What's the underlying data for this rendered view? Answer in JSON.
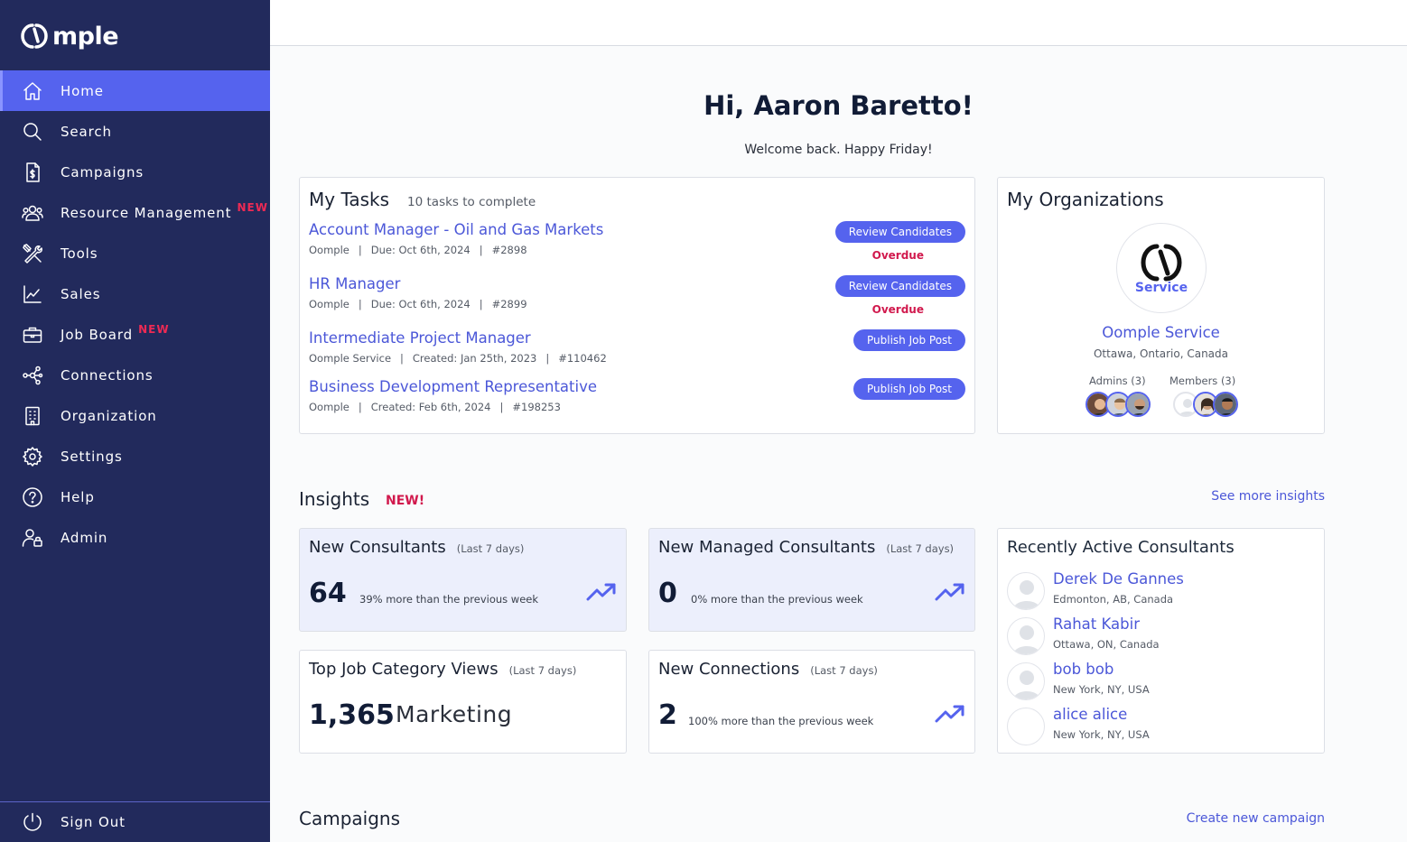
{
  "app": {
    "name": "Oomple",
    "logo_text": "mple"
  },
  "sidebar": {
    "items": [
      {
        "label": "Home",
        "icon": "home-icon",
        "active": true
      },
      {
        "label": "Search",
        "icon": "search-icon"
      },
      {
        "label": "Campaigns",
        "icon": "campaign-doc-icon"
      },
      {
        "label": "Resource Management",
        "icon": "users-icon",
        "badge": "NEW"
      },
      {
        "label": "Tools",
        "icon": "tools-icon"
      },
      {
        "label": "Sales",
        "icon": "chart-line-icon"
      },
      {
        "label": "Job Board",
        "icon": "briefcase-icon",
        "badge": "NEW"
      },
      {
        "label": "Connections",
        "icon": "network-icon"
      },
      {
        "label": "Organization",
        "icon": "building-icon"
      },
      {
        "label": "Settings",
        "icon": "gear-icon"
      },
      {
        "label": "Help",
        "icon": "help-circle-icon"
      },
      {
        "label": "Admin",
        "icon": "user-lock-icon"
      }
    ],
    "sign_out": "Sign Out"
  },
  "greeting": {
    "title": "Hi, Aaron Baretto!",
    "subtitle": "Welcome back. Happy Friday!"
  },
  "tasks": {
    "title": "My Tasks",
    "count_text": "10 tasks to complete",
    "items": [
      {
        "title": "Account Manager - Oil and Gas Markets",
        "org": "Oomple",
        "date": "Due: Oct 6th, 2024",
        "id": "#2898",
        "action": "Review Candidates",
        "status": "Overdue"
      },
      {
        "title": "HR Manager",
        "org": "Oomple",
        "date": "Due: Oct 6th, 2024",
        "id": "#2899",
        "action": "Review Candidates",
        "status": "Overdue"
      },
      {
        "title": "Intermediate Project Manager",
        "org": "Oomple Service",
        "date": "Created: Jan 25th, 2023",
        "id": "#110462",
        "action": "Publish Job Post"
      },
      {
        "title": "Business Development Representative",
        "org": "Oomple",
        "date": "Created: Feb 6th, 2024",
        "id": "#198253",
        "action": "Publish Job Post"
      }
    ]
  },
  "organizations": {
    "title": "My Organizations",
    "logo_label": "Service",
    "name": "Oomple Service",
    "location": "Ottawa, Ontario, Canada",
    "admins_label": "Admins (3)",
    "members_label": "Members (3)"
  },
  "insights": {
    "title": "Insights",
    "new_flag": "NEW!",
    "see_more": "See more insights",
    "new_consultants": {
      "title": "New Consultants",
      "period": "(Last 7 days)",
      "value": "64",
      "note": "39% more than the previous week"
    },
    "new_managed": {
      "title": "New Managed Consultants",
      "period": "(Last 7 days)",
      "value": "0",
      "note": "0% more than the previous week"
    },
    "top_job": {
      "title": "Top Job Category Views",
      "period": "(Last 7 days)",
      "value": "1,365",
      "category": "Marketing"
    },
    "new_connections": {
      "title": "New Connections",
      "period": "(Last 7 days)",
      "value": "2",
      "note": "100% more than the previous week"
    },
    "recent": {
      "title": "Recently Active Consultants",
      "items": [
        {
          "name": "Derek De Gannes",
          "location": "Edmonton, AB, Canada"
        },
        {
          "name": "Rahat Kabir",
          "location": "Ottawa, ON, Canada"
        },
        {
          "name": "bob bob",
          "location": "New York, NY, USA"
        },
        {
          "name": "alice alice",
          "location": "New York, NY, USA"
        }
      ]
    }
  },
  "campaigns": {
    "title": "Campaigns",
    "create": "Create new campaign"
  },
  "colors": {
    "sidebar": "#222a5c",
    "accent": "#5563ee",
    "alert": "#d1194d",
    "link": "#4b57d8"
  }
}
